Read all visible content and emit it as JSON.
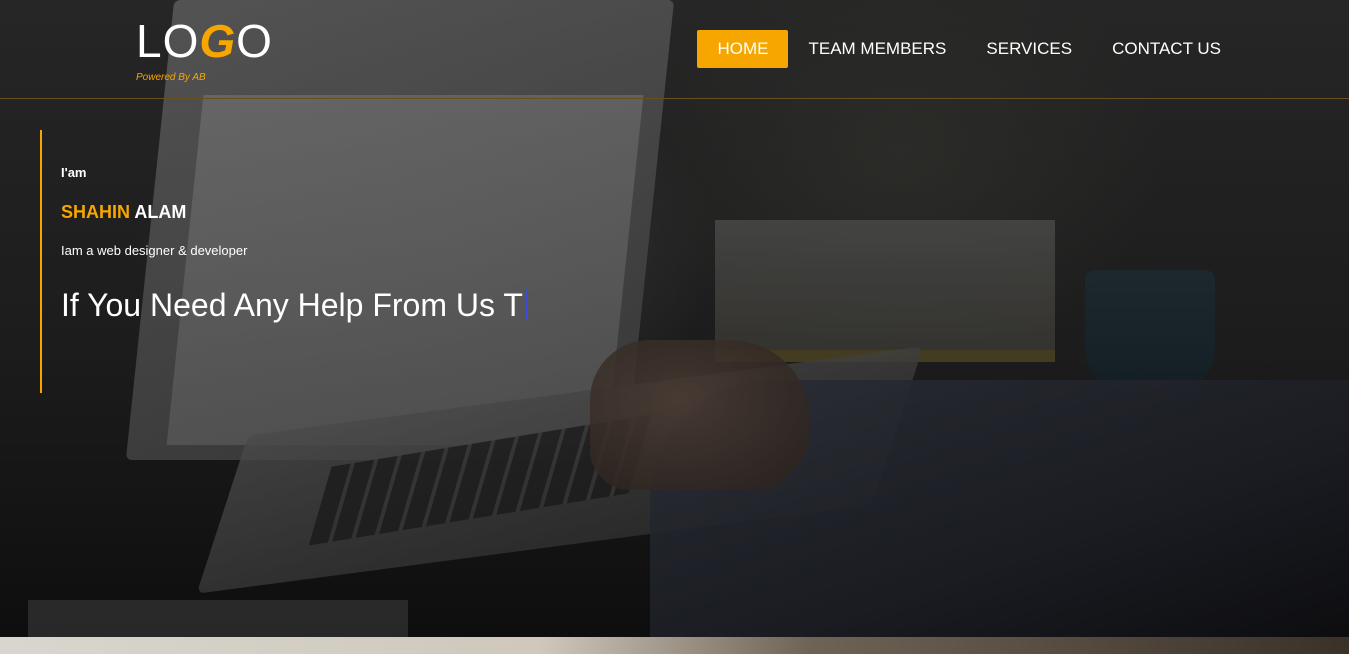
{
  "logo": {
    "part1": "LO",
    "accent": "G",
    "part2": "O",
    "tagline": "Powered By AB"
  },
  "nav": {
    "items": [
      {
        "label": "HOME",
        "active": true
      },
      {
        "label": "TEAM MEMBERS",
        "active": false
      },
      {
        "label": "SERVICES",
        "active": false
      },
      {
        "label": "CONTACT US",
        "active": false
      }
    ]
  },
  "intro": {
    "iam": "I'am",
    "first_name": "SHAHIN",
    "last_name": "ALAM",
    "role": "Iam a web designer & developer",
    "typing_text": "If You Need Any Help From Us T"
  },
  "colors": {
    "accent": "#f7a600",
    "cursor": "#3b4be0"
  }
}
